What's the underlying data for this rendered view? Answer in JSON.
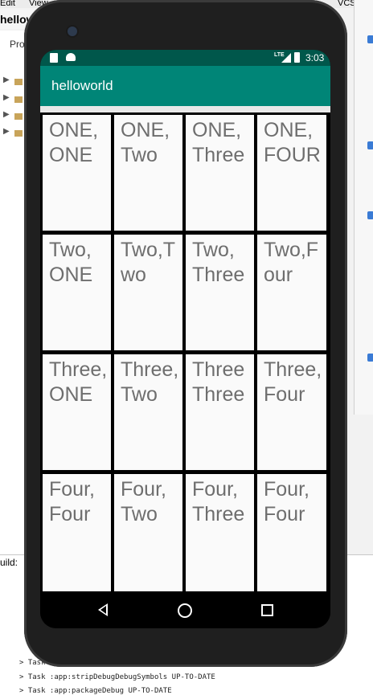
{
  "ide": {
    "menu": [
      "Edit",
      "View",
      "VCS"
    ],
    "title": "hellowo",
    "project_label": "Pro",
    "build_label": "uild:",
    "log_lines": [
      "> Task :app:stripDebugDebugSymbols UP-TO-DATE",
      "> Task :app:packageDebug UP-TO-DATE"
    ],
    "log_prefix": "> Task"
  },
  "status_bar": {
    "network": "LTE",
    "time": "3:03",
    "color": "#00574b"
  },
  "app_bar": {
    "title": "helloworld",
    "color": "#008577"
  },
  "grid": {
    "rows": [
      [
        "ONE,\nONE",
        "ONE,\nTwo",
        "ONE,\nThree",
        "ONE,\nFOUR"
      ],
      [
        "Two,\nONE",
        "Two,Two",
        "Two,\nThree",
        "Two,Four"
      ],
      [
        "Three,ONE",
        "Three,Two",
        "Three\nThree",
        "Three,Four"
      ],
      [
        "Four,\nFour",
        "Four,\nTwo",
        "Four,\nThree",
        "Four,\nFour"
      ]
    ],
    "text_color": "#6e6e6e",
    "cell_color": "#fafafa"
  },
  "nav_bar": {
    "back_icon": "back-triangle-icon",
    "home_icon": "home-circle-icon",
    "recents_icon": "recents-square-icon"
  }
}
